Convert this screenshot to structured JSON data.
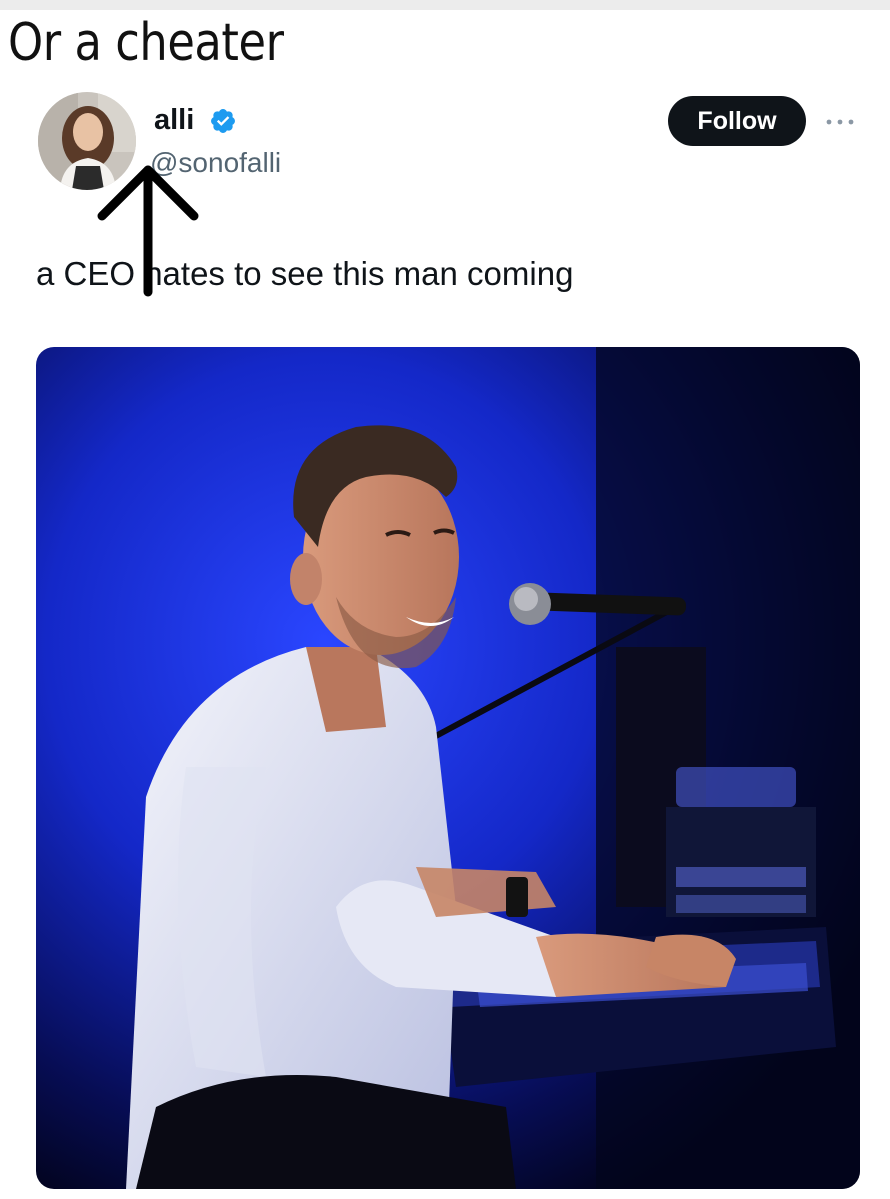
{
  "meme": {
    "caption": "Or a cheater"
  },
  "tweet": {
    "author": {
      "display_name": "alli",
      "handle": "@sonofalli",
      "verified": true
    },
    "follow_label": "Follow",
    "text": "a CEO hates to see this man coming",
    "media": {
      "description_icon": "photo-of-smiling-man-at-piano"
    }
  },
  "colors": {
    "follow_button": "#0f1419",
    "verified_badge": "#1d9bf0",
    "handle_gray": "#536471",
    "photo_blue": "#1a2fd6"
  }
}
